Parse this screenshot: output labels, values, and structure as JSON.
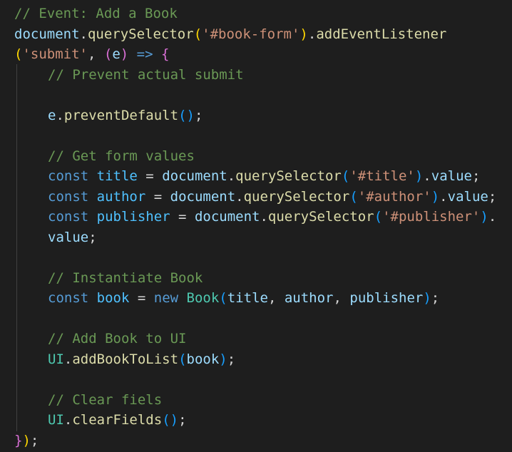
{
  "editor": {
    "theme_colors": {
      "background": "#1e1e1e",
      "comment": "#6a9955",
      "variable": "#9cdcfe",
      "function": "#dcdcaa",
      "string": "#ce9178",
      "keyword": "#569cd6",
      "class": "#4ec9b0",
      "bracket_gold": "#ffd700",
      "bracket_purple": "#da70d6",
      "bracket_blue": "#179fff"
    },
    "lines": [
      [
        {
          "t": "// Event: Add a Book",
          "c": "comment"
        }
      ],
      [
        {
          "t": "document",
          "c": "var"
        },
        {
          "t": ".",
          "c": "punct"
        },
        {
          "t": "querySelector",
          "c": "fn"
        },
        {
          "t": "(",
          "c": "brace"
        },
        {
          "t": "'#book-form'",
          "c": "str"
        },
        {
          "t": ")",
          "c": "brace"
        },
        {
          "t": ".",
          "c": "punct"
        },
        {
          "t": "addEventListener",
          "c": "fn"
        }
      ],
      [
        {
          "t": "(",
          "c": "brace"
        },
        {
          "t": "'submit'",
          "c": "str"
        },
        {
          "t": ", ",
          "c": "punct"
        },
        {
          "t": "(",
          "c": "paren1"
        },
        {
          "t": "e",
          "c": "var"
        },
        {
          "t": ")",
          "c": "paren1"
        },
        {
          "t": " ",
          "c": "punct"
        },
        {
          "t": "=>",
          "c": "kw"
        },
        {
          "t": " ",
          "c": "punct"
        },
        {
          "t": "{",
          "c": "paren1"
        }
      ],
      [
        {
          "indent": 1
        },
        {
          "t": "// Prevent actual submit",
          "c": "comment"
        }
      ],
      [],
      [
        {
          "indent": 1
        },
        {
          "t": "e",
          "c": "var"
        },
        {
          "t": ".",
          "c": "punct"
        },
        {
          "t": "preventDefault",
          "c": "fn"
        },
        {
          "t": "()",
          "c": "paren2"
        },
        {
          "t": ";",
          "c": "punct"
        }
      ],
      [],
      [
        {
          "indent": 1
        },
        {
          "t": "// Get form values",
          "c": "comment"
        }
      ],
      [
        {
          "indent": 1
        },
        {
          "t": "const",
          "c": "kw"
        },
        {
          "t": " ",
          "c": "punct"
        },
        {
          "t": "title",
          "c": "const"
        },
        {
          "t": " = ",
          "c": "op"
        },
        {
          "t": "document",
          "c": "var"
        },
        {
          "t": ".",
          "c": "punct"
        },
        {
          "t": "querySelector",
          "c": "fn"
        },
        {
          "t": "(",
          "c": "paren2"
        },
        {
          "t": "'#title'",
          "c": "str"
        },
        {
          "t": ")",
          "c": "paren2"
        },
        {
          "t": ".",
          "c": "punct"
        },
        {
          "t": "value",
          "c": "var"
        },
        {
          "t": ";",
          "c": "punct"
        }
      ],
      [
        {
          "indent": 1
        },
        {
          "t": "const",
          "c": "kw"
        },
        {
          "t": " ",
          "c": "punct"
        },
        {
          "t": "author",
          "c": "const"
        },
        {
          "t": " = ",
          "c": "op"
        },
        {
          "t": "document",
          "c": "var"
        },
        {
          "t": ".",
          "c": "punct"
        },
        {
          "t": "querySelector",
          "c": "fn"
        },
        {
          "t": "(",
          "c": "paren2"
        },
        {
          "t": "'#author'",
          "c": "str"
        },
        {
          "t": ")",
          "c": "paren2"
        },
        {
          "t": ".",
          "c": "punct"
        },
        {
          "t": "value",
          "c": "var"
        },
        {
          "t": ";",
          "c": "punct"
        }
      ],
      [
        {
          "indent": 1
        },
        {
          "t": "const",
          "c": "kw"
        },
        {
          "t": " ",
          "c": "punct"
        },
        {
          "t": "publisher",
          "c": "const"
        },
        {
          "t": " = ",
          "c": "op"
        },
        {
          "t": "document",
          "c": "var"
        },
        {
          "t": ".",
          "c": "punct"
        },
        {
          "t": "querySelector",
          "c": "fn"
        },
        {
          "t": "(",
          "c": "paren2"
        },
        {
          "t": "'#publisher'",
          "c": "str"
        },
        {
          "t": ")",
          "c": "paren2"
        },
        {
          "t": ".",
          "c": "punct"
        }
      ],
      [
        {
          "indent": 1
        },
        {
          "t": "value",
          "c": "var"
        },
        {
          "t": ";",
          "c": "punct"
        }
      ],
      [],
      [
        {
          "indent": 1
        },
        {
          "t": "// Instantiate Book",
          "c": "comment"
        }
      ],
      [
        {
          "indent": 1
        },
        {
          "t": "const",
          "c": "kw"
        },
        {
          "t": " ",
          "c": "punct"
        },
        {
          "t": "book",
          "c": "const"
        },
        {
          "t": " = ",
          "c": "op"
        },
        {
          "t": "new",
          "c": "kw"
        },
        {
          "t": " ",
          "c": "punct"
        },
        {
          "t": "Book",
          "c": "class"
        },
        {
          "t": "(",
          "c": "paren2"
        },
        {
          "t": "title",
          "c": "var"
        },
        {
          "t": ", ",
          "c": "punct"
        },
        {
          "t": "author",
          "c": "var"
        },
        {
          "t": ", ",
          "c": "punct"
        },
        {
          "t": "publisher",
          "c": "var"
        },
        {
          "t": ")",
          "c": "paren2"
        },
        {
          "t": ";",
          "c": "punct"
        }
      ],
      [],
      [
        {
          "indent": 1
        },
        {
          "t": "// Add Book to UI",
          "c": "comment"
        }
      ],
      [
        {
          "indent": 1
        },
        {
          "t": "UI",
          "c": "class"
        },
        {
          "t": ".",
          "c": "punct"
        },
        {
          "t": "addBookToList",
          "c": "fn"
        },
        {
          "t": "(",
          "c": "paren2"
        },
        {
          "t": "book",
          "c": "var"
        },
        {
          "t": ")",
          "c": "paren2"
        },
        {
          "t": ";",
          "c": "punct"
        }
      ],
      [],
      [
        {
          "indent": 1
        },
        {
          "t": "// Clear fiels",
          "c": "comment"
        }
      ],
      [
        {
          "indent": 1
        },
        {
          "t": "UI",
          "c": "class"
        },
        {
          "t": ".",
          "c": "punct"
        },
        {
          "t": "clearFields",
          "c": "fn"
        },
        {
          "t": "()",
          "c": "paren2"
        },
        {
          "t": ";",
          "c": "punct"
        }
      ],
      [
        {
          "t": "}",
          "c": "paren1"
        },
        {
          "t": ")",
          "c": "brace"
        },
        {
          "t": ";",
          "c": "punct"
        }
      ]
    ]
  }
}
